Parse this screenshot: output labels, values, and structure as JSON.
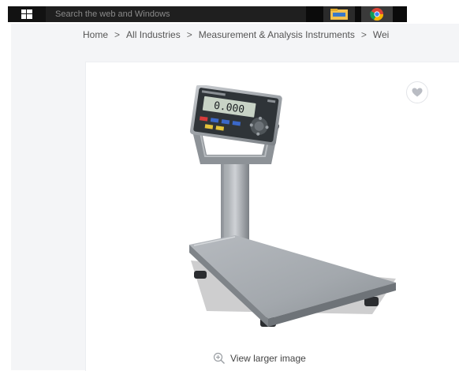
{
  "taskbar": {
    "search_placeholder": "Search the web and Windows",
    "apps": [
      "file-explorer-icon",
      "chrome-icon"
    ]
  },
  "breadcrumb": {
    "items": [
      "Home",
      "All Industries",
      "Measurement & Analysis Instruments",
      "Wei"
    ],
    "separator": ">"
  },
  "product": {
    "display_reading": "0.000",
    "view_larger_label": "View larger image"
  },
  "colors": {
    "taskbar": "#0b0b0b",
    "page_background": "#f4f5f7",
    "card_background": "#ffffff"
  }
}
